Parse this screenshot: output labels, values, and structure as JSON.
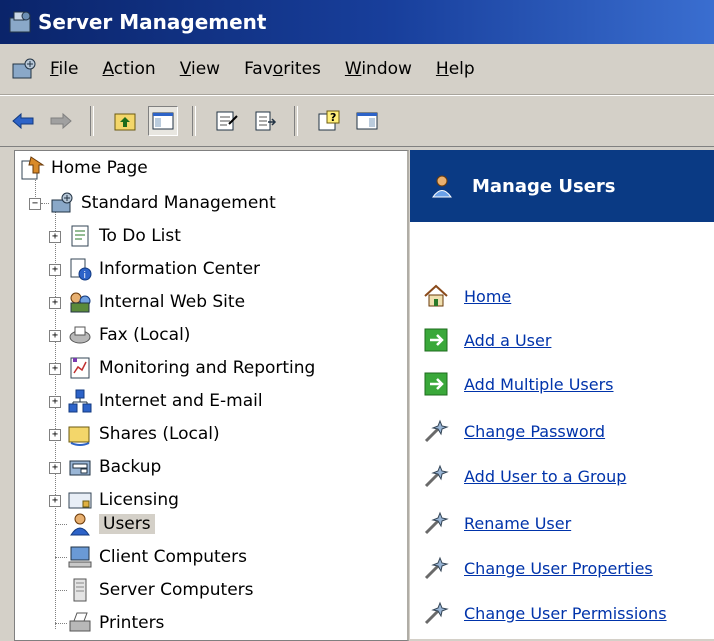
{
  "window": {
    "title": "Server Management",
    "app_icon": "server-management-icon"
  },
  "menubar": {
    "icon": "console-icon",
    "items": [
      {
        "label": "File",
        "access": "F",
        "rest": "ile"
      },
      {
        "label": "Action",
        "access": "A",
        "rest": "ction"
      },
      {
        "label": "View",
        "access": "V",
        "rest": "iew"
      },
      {
        "label": "Favorites",
        "pre": "Fav",
        "access": "o",
        "rest": "rites"
      },
      {
        "label": "Window",
        "access": "W",
        "rest": "indow"
      },
      {
        "label": "Help",
        "access": "H",
        "rest": "elp"
      }
    ]
  },
  "toolbar": {
    "buttons": [
      "back-arrow-icon",
      "forward-arrow-icon",
      "up-folder-icon",
      "show-hide-tree-icon",
      "properties-icon",
      "export-list-icon",
      "help-icon",
      "show-hide-action-pane-icon"
    ]
  },
  "tree": {
    "root": {
      "label": "Home Page",
      "icon": "home-page-icon"
    },
    "group": {
      "label": "Standard Management",
      "icon": "standard-management-icon"
    },
    "items": [
      {
        "label": "To Do List",
        "icon": "todo-list-icon",
        "expandable": true
      },
      {
        "label": "Information Center",
        "icon": "information-center-icon",
        "expandable": true
      },
      {
        "label": "Internal Web Site",
        "icon": "internal-web-site-icon",
        "expandable": true
      },
      {
        "label": "Fax (Local)",
        "icon": "fax-icon",
        "expandable": true
      },
      {
        "label": "Monitoring and Reporting",
        "icon": "monitoring-icon",
        "expandable": true
      },
      {
        "label": "Internet and E-mail",
        "icon": "internet-email-icon",
        "expandable": true
      },
      {
        "label": "Shares (Local)",
        "icon": "shares-icon",
        "expandable": true
      },
      {
        "label": "Backup",
        "icon": "backup-icon",
        "expandable": true
      },
      {
        "label": "Licensing",
        "icon": "licensing-icon",
        "expandable": true
      },
      {
        "label": "Users",
        "icon": "users-icon",
        "expandable": false,
        "selected": true
      },
      {
        "label": "Client Computers",
        "icon": "client-computers-icon",
        "expandable": false
      },
      {
        "label": "Server Computers",
        "icon": "server-computers-icon",
        "expandable": false
      },
      {
        "label": "Printers",
        "icon": "printers-icon",
        "expandable": false
      }
    ],
    "expander_symbol": "+",
    "collapse_symbol": "−"
  },
  "right_pane": {
    "header": {
      "title": "Manage Users",
      "icon": "manage-users-icon"
    },
    "tasks": [
      {
        "label": "Home",
        "icon": "home-icon"
      },
      {
        "label": "Add a User",
        "icon": "green-arrow-icon"
      },
      {
        "label": "Add Multiple Users",
        "icon": "green-arrow-icon"
      },
      {
        "label": "Change Password",
        "icon": "wizard-icon"
      },
      {
        "label": "Add User to a Group",
        "icon": "wizard-icon"
      },
      {
        "label": "Rename User",
        "icon": "wizard-icon"
      },
      {
        "label": "Change User Properties",
        "icon": "wizard-icon"
      },
      {
        "label": "Change User Permissions",
        "icon": "wizard-icon"
      }
    ]
  },
  "colors": {
    "title_bar": "#0a246a",
    "header_bar": "#0a3a84",
    "link": "#0033aa",
    "chrome": "#d4d0c8"
  }
}
